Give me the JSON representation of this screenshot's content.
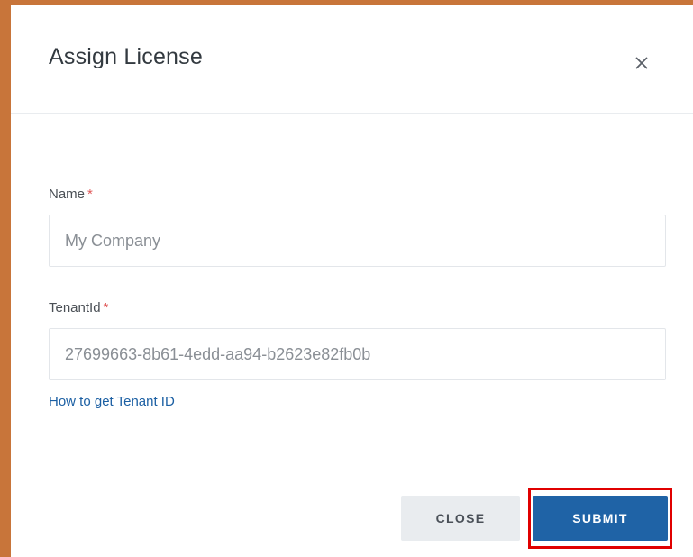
{
  "dialog": {
    "title": "Assign License",
    "close_icon": "close-icon"
  },
  "form": {
    "name": {
      "label": "Name",
      "required_marker": "*",
      "placeholder": "My Company"
    },
    "tenant_id": {
      "label": "TenantId",
      "required_marker": "*",
      "placeholder": "27699663-8b61-4edd-aa94-b2623e82fb0b"
    },
    "help_link": "How to get Tenant ID"
  },
  "footer": {
    "close_label": "CLOSE",
    "submit_label": "SUBMIT"
  },
  "colors": {
    "frame_border": "#c8753a",
    "primary": "#1f63a6",
    "highlight": "#e00000",
    "required": "#e05858",
    "link": "#1b5fa3"
  }
}
